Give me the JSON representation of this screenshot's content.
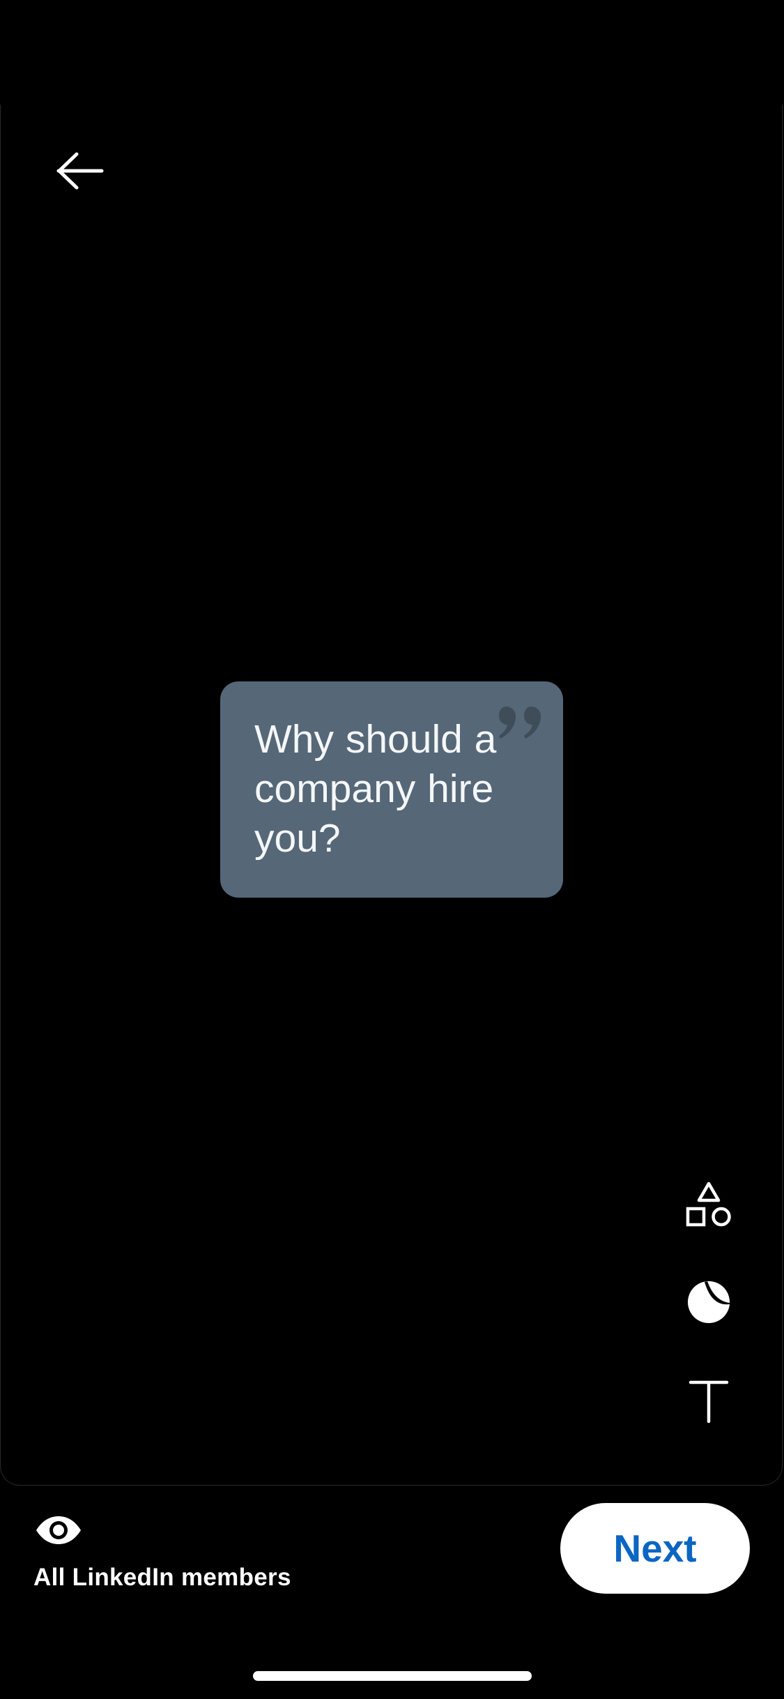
{
  "header": {
    "back_icon": "arrow-left-icon"
  },
  "card": {
    "text": "Why should a company hire you?",
    "background_color": "#566777",
    "decor_icon": "quote-icon"
  },
  "tools": [
    {
      "icon": "shapes-icon"
    },
    {
      "icon": "sticker-icon"
    },
    {
      "icon": "text-tool-icon"
    }
  ],
  "footer": {
    "visibility_icon": "eye-icon",
    "visibility_label": "All LinkedIn members",
    "next_label": "Next",
    "accent_color": "#0a66c2"
  }
}
